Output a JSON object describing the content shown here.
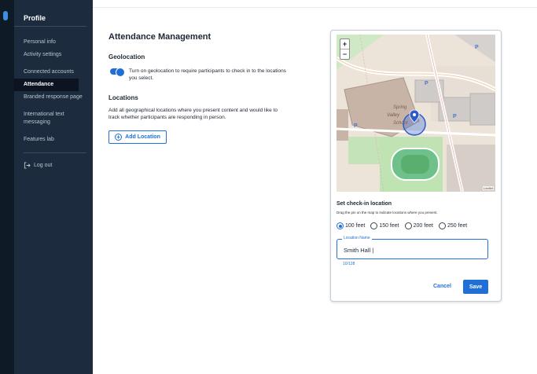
{
  "sidebar": {
    "title": "Profile",
    "items": [
      {
        "label": "Personal info"
      },
      {
        "label": "Activity settings"
      },
      {
        "label": "Connected accounts"
      },
      {
        "label": "Attendance"
      },
      {
        "label": "Branded response page"
      },
      {
        "label": "International text messaging"
      },
      {
        "label": "Features lab"
      }
    ],
    "logout_label": "Log out"
  },
  "page": {
    "title": "Attendance Management",
    "geolocation": {
      "heading": "Geolocation",
      "toggle_text": "Turn on geolocation to require participants to check in to the locations you select."
    },
    "locations": {
      "heading": "Locations",
      "description": "Add all geographical locations where you present content and would like to track whether participants are responding in person.",
      "add_button": "Add Location"
    }
  },
  "dialog": {
    "map": {
      "zoom_in": "+",
      "zoom_out": "−",
      "label_spring": "Spring",
      "label_valley": "Valley",
      "label_school": "School",
      "attribution": "Leaflet",
      "parking_marker": "P"
    },
    "heading": "Set check-in location",
    "description": "Drag the pin on the map to indicate locations where you present.",
    "radius_options": [
      {
        "label": "100 feet",
        "selected": true
      },
      {
        "label": "150 feet",
        "selected": false
      },
      {
        "label": "200 feet",
        "selected": false
      },
      {
        "label": "250 feet",
        "selected": false
      }
    ],
    "location_field": {
      "label": "Location Name",
      "value": "Smith Hall |"
    },
    "counter": "10/128",
    "cancel": "Cancel",
    "save": "Save"
  },
  "colors": {
    "accent": "#1f6fd6",
    "sidebar_bg": "#1c2b3d",
    "sidebar_active": "#0b1420"
  }
}
